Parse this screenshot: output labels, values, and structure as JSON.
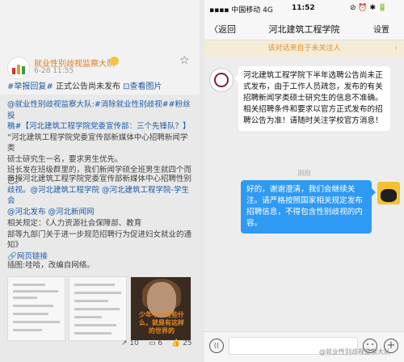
{
  "weibo": {
    "user_name": "就业性别歧视监察大队",
    "time": "6-28 11:55",
    "title_tag": "#举报回复#",
    "title_text": " 正式公告尚未发布 ",
    "title_link": "⊡查看图片",
    "repost_lines": [
      "@就业性别歧视监察大队:#消除就业性别歧视##粉丝投",
      "稿#【河北建筑工程学院党委宣传部：三个先锋队？】",
      "“河北建筑工程学院党委宣传部新媒体中心招聘新闻学类",
      "硕士研究生一名，要求男生优先。",
      "班长发在班级群里的，我们新闻学硕全班男生就四个而",
      "已。”"
    ],
    "report_lines": [
      "举报河北建筑工程学院党委宣传部新媒体中心招聘性别",
      "歧视。@河北建筑工程学院 @河北建筑工程学院-学生会",
      "@河北发布 @河北新闻网"
    ],
    "law_lines": [
      "相关规定：《人力资源社会保障部、教育",
      "部等九部门关于进一步规范招聘行为促进妇女就业的通",
      "知》",
      "🔗网页链接"
    ],
    "caption": "插图:哇哈，改编自网络。",
    "portrait_overlay": "少年不了有些什么，就是有这样的世界的",
    "action_repost": "↗ 10",
    "action_comment": "▭ 6",
    "action_like": "👍 25"
  },
  "wechat": {
    "carrier": "中国移动",
    "network": "4G",
    "time": "11:52",
    "status_icons": "⊘ ⏰ ✱ 🔋",
    "back_label": "〈返回",
    "chat_title": "河北建筑工程学院",
    "settings_label": "设置",
    "warning": "该对话来自于未关注人",
    "incoming_message": "河北建筑工程学院下半年选聘公告尚未正式发布，由于工作人员疏忽，发布的有关招聘新闻学类硕士研究生的信息不准确。相关招聘条件和要求以官方正式发布的招聘公告为准！请随时关注学校官方消息！",
    "divider": "刚刚",
    "outgoing_message": "好的，谢谢澄清，我们会继续关注。请严格按照国家相关规定发布招聘信息，不得包含性别歧视的内容。",
    "input_placeholder": "",
    "watermark": "@就业性别歧视监察大队"
  },
  "colors": {
    "link_blue": "#1d5ba8",
    "username_orange": "#e07a1f",
    "warning_orange": "#e08e2a",
    "bubble_blue": "#2f9af3"
  }
}
